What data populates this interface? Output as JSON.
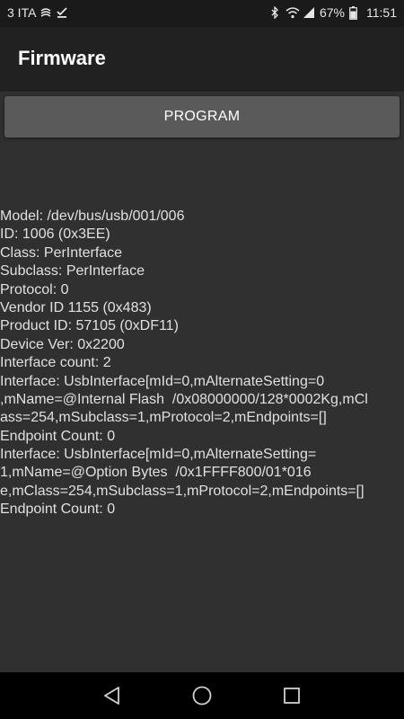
{
  "status_bar": {
    "carrier": "3 ITA",
    "battery": "67%",
    "time": "11:51",
    "icons_left": [
      "signal-swirl-icon",
      "download-check-icon"
    ],
    "icons_right": [
      "bluetooth-icon",
      "wifi-icon",
      "cell-signal-icon",
      "battery-icon"
    ]
  },
  "app_bar": {
    "title": "Firmware"
  },
  "program_button": {
    "label": "PROGRAM"
  },
  "info": {
    "lines": [
      "Model: /dev/bus/usb/001/006",
      "ID: 1006 (0x3EE)",
      "Class: PerInterface",
      "Subclass: PerInterface",
      "Protocol: 0",
      "Vendor ID 1155 (0x483)",
      "Product ID: 57105 (0xDF11)",
      "Device Ver: 0x2200",
      "Interface count: 2",
      "Interface: UsbInterface[mId=0,mAlternateSetting=0",
      ",mName=@Internal Flash  /0x08000000/128*0002Kg,mCl",
      "ass=254,mSubclass=1,mProtocol=2,mEndpoints=[]",
      "Endpoint Count: 0",
      "Interface: UsbInterface[mId=0,mAlternateSetting=",
      "1,mName=@Option Bytes  /0x1FFFF800/01*016",
      "e,mClass=254,mSubclass=1,mProtocol=2,mEndpoints=[]",
      "Endpoint Count: 0"
    ]
  },
  "nav_bar": {
    "buttons": [
      "back-icon",
      "home-icon",
      "recents-icon"
    ]
  },
  "colors": {
    "background": "#303030",
    "app_bar": "#212121",
    "status_bar": "#1a1a1a",
    "button": "#5a5a5a",
    "text": "#e0e0e0",
    "nav_bar": "#000000"
  }
}
